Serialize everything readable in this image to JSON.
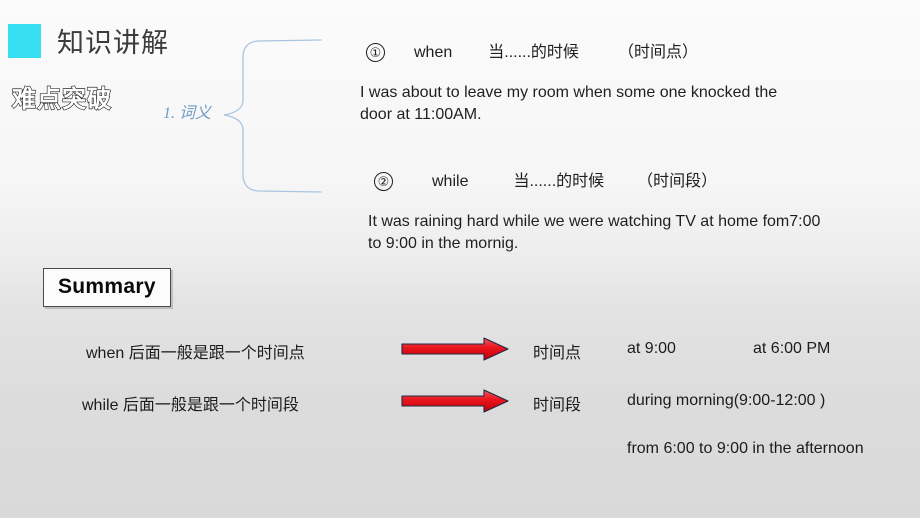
{
  "header": {
    "title": "知识讲解",
    "section_heading": "难点突破",
    "subtopic": "1. 词义",
    "accent_color": "#35dff1"
  },
  "definitions": [
    {
      "number": "①",
      "keyword": "when",
      "meaning": "当......的时候",
      "note": "（时间点）",
      "example": "I was about to  leave my room when some one knocked the door at 11:00AM."
    },
    {
      "number": "②",
      "keyword": "while",
      "meaning": "当......的时候",
      "note": "（时间段）",
      "example": "It was raining hard  while we were watching TV at home fom7:00 to 9:00 in the mornig."
    }
  ],
  "summary": {
    "box_label": "Summary",
    "arrow_color": "#e8141c",
    "rows": [
      {
        "rule": "when 后面一般是跟一个时间点",
        "type": "时间点",
        "example_a": "at  9:00",
        "example_b": "at 6:00 PM"
      },
      {
        "rule": "while 后面一般是跟一个时间段",
        "type": "时间段",
        "example_a": "during morning(9:00-12:00 )",
        "example_b": "from 6:00 to 9:00 in the afternoon"
      }
    ]
  }
}
